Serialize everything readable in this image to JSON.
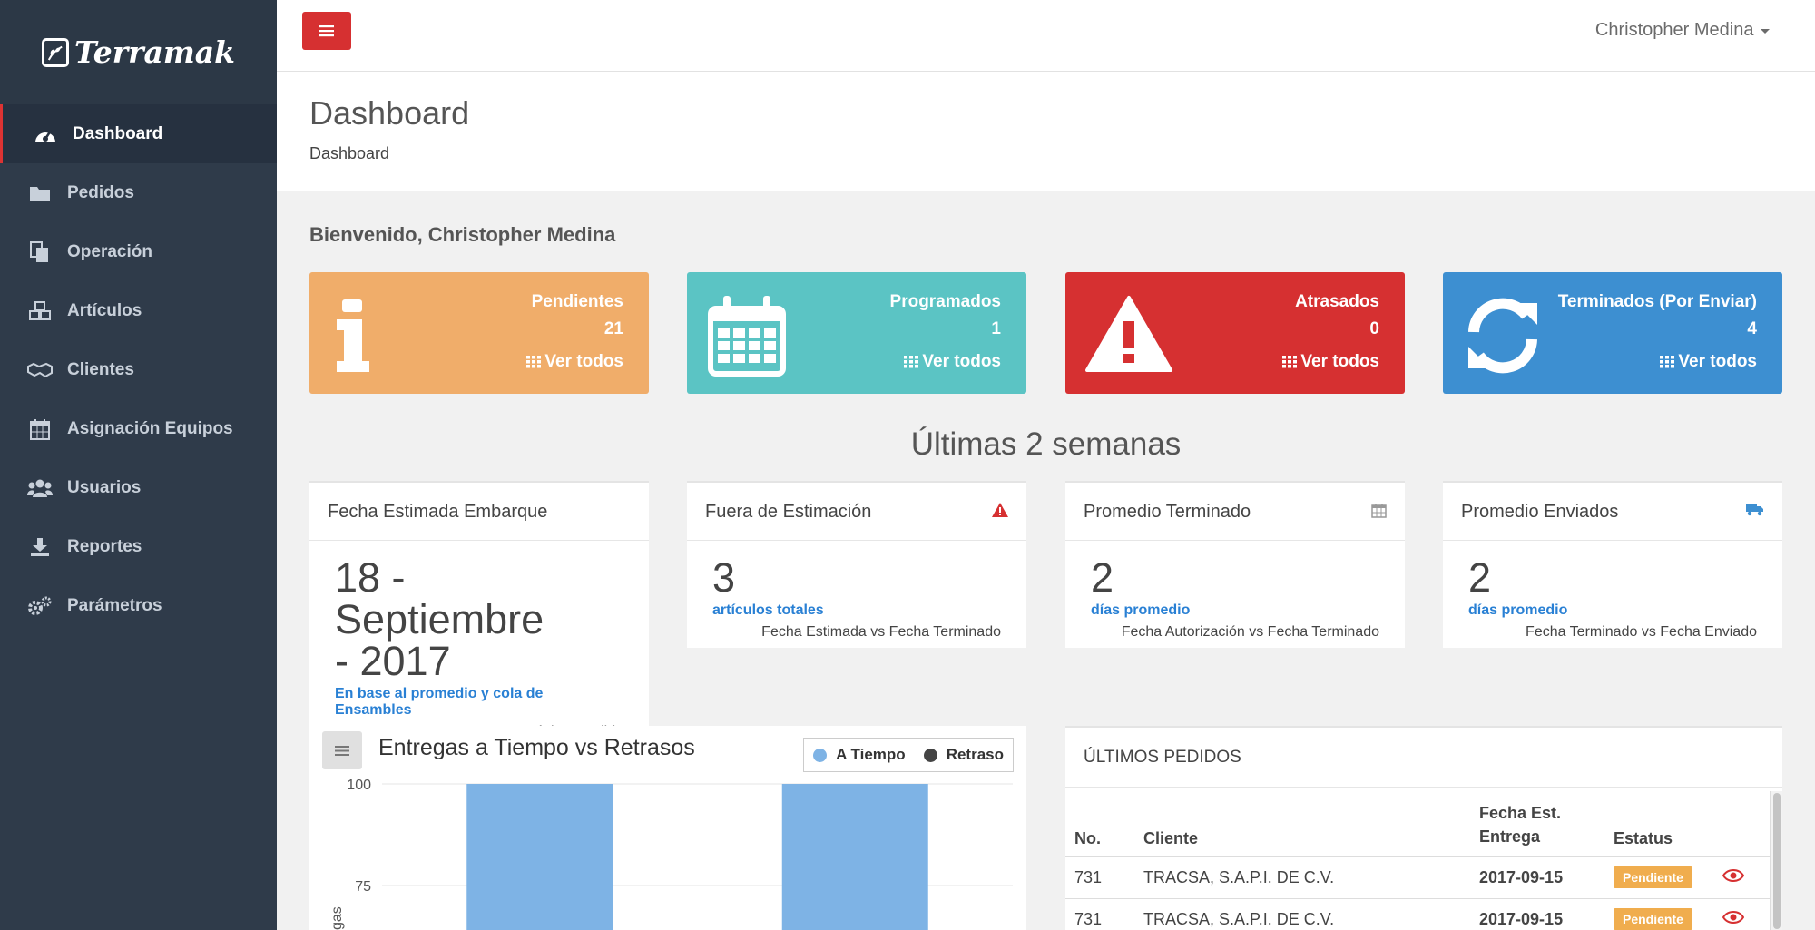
{
  "app": {
    "name": "Terramak"
  },
  "sidebar": {
    "items": [
      {
        "label": "Dashboard",
        "icon": "dashboard-icon",
        "active": true
      },
      {
        "label": "Pedidos",
        "icon": "folder-icon"
      },
      {
        "label": "Operación",
        "icon": "copy-icon"
      },
      {
        "label": "Artículos",
        "icon": "cubes-icon"
      },
      {
        "label": "Clientes",
        "icon": "handshake-icon"
      },
      {
        "label": "Asignación Equipos",
        "icon": "calendar-icon"
      },
      {
        "label": "Usuarios",
        "icon": "users-icon"
      },
      {
        "label": "Reportes",
        "icon": "download-icon"
      },
      {
        "label": "Parámetros",
        "icon": "gears-icon"
      }
    ]
  },
  "topbar": {
    "user_name": "Christopher Medina"
  },
  "header": {
    "title": "Dashboard",
    "breadcrumb": "Dashboard"
  },
  "welcome": "Bienvenido, Christopher Medina",
  "stats": [
    {
      "title": "Pendientes",
      "count": "21",
      "link": "Ver todos",
      "color": "#f0ad6a",
      "icon": "info-icon"
    },
    {
      "title": "Programados",
      "count": "1",
      "link": "Ver todos",
      "color": "#5bc4c4",
      "icon": "calendar-icon"
    },
    {
      "title": "Atrasados",
      "count": "0",
      "link": "Ver todos",
      "color": "#d63031",
      "icon": "warning-icon"
    },
    {
      "title": "Terminados (Por Enviar)",
      "count": "4",
      "link": "Ver todos",
      "color": "#3d8fd1",
      "icon": "refresh-icon"
    }
  ],
  "section_title": "Últimas 2 semanas",
  "panels": [
    {
      "title": "Fecha Estimada Embarque",
      "value_line1": "18 - Septiembre",
      "value_line2": "- 2017",
      "sub": "En base al promedio y cola de Ensambles",
      "note": "Próximo Pedido"
    },
    {
      "title": "Fuera de Estimación",
      "value": "3",
      "sub": "artículos totales",
      "note": "Fecha Estimada vs Fecha Terminado",
      "icon": "warning-icon"
    },
    {
      "title": "Promedio Terminado",
      "value": "2",
      "sub": "días promedio",
      "note": "Fecha Autorización vs Fecha Terminado",
      "icon": "calendar-icon"
    },
    {
      "title": "Promedio Enviados",
      "value": "2",
      "sub": "días promedio",
      "note": "Fecha Terminado vs Fecha Enviado",
      "icon": "truck-icon"
    }
  ],
  "chart": {
    "title": "Entregas a Tiempo vs Retrasos",
    "ylabel_visible": "gas",
    "ticks": [
      "100",
      "75"
    ],
    "legend": [
      "A Tiempo",
      "Retraso"
    ]
  },
  "chart_data": {
    "type": "bar",
    "title": "Entregas a Tiempo vs Retrasos",
    "categories": [
      "",
      ""
    ],
    "series": [
      {
        "name": "A Tiempo",
        "color": "#7eb3e5",
        "values": [
          100,
          100
        ]
      },
      {
        "name": "Retraso",
        "color": "#444444",
        "values": [
          0,
          0
        ]
      }
    ],
    "ylim": [
      0,
      100
    ],
    "yticks_visible": [
      75,
      100
    ],
    "legend_position": "top-right",
    "grid": true
  },
  "orders": {
    "title": "ÚLTIMOS PEDIDOS",
    "columns": [
      "No.",
      "Cliente",
      "Fecha Est. Entrega",
      "Estatus",
      ""
    ],
    "rows": [
      {
        "no": "731",
        "cliente": "TRACSA, S.A.P.I. DE C.V.",
        "fecha": "2017-09-15",
        "estatus": "Pendiente"
      },
      {
        "no": "731",
        "cliente": "TRACSA, S.A.P.I. DE C.V.",
        "fecha": "2017-09-15",
        "estatus": "Pendiente"
      }
    ]
  }
}
